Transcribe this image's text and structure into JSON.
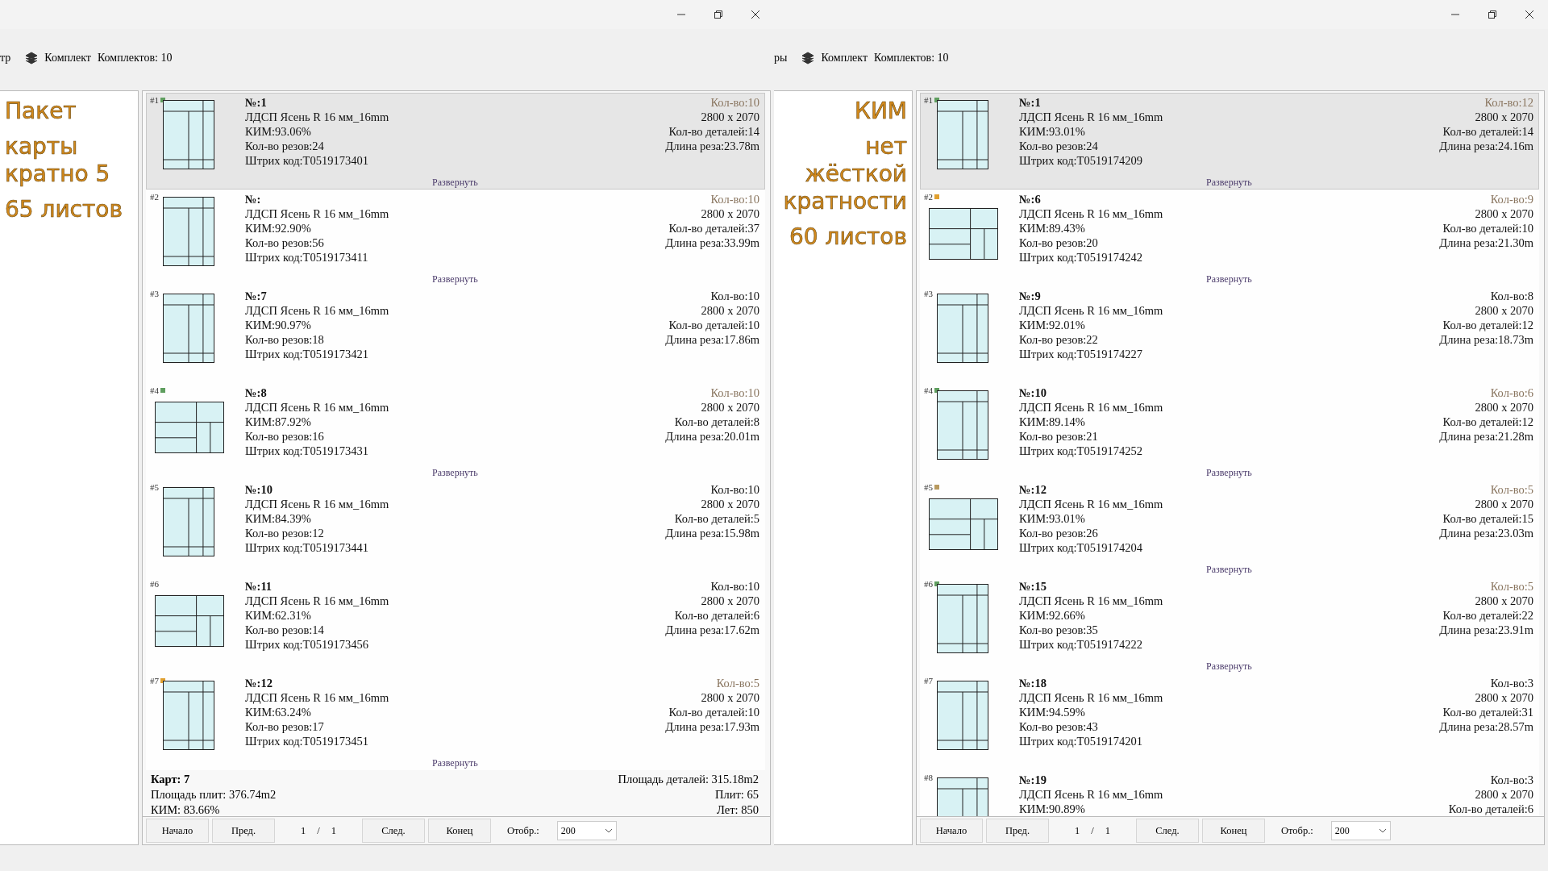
{
  "windows": [
    {
      "toolbar": {
        "cut_label": "тр",
        "set_label": "Комплект",
        "sets_count": "Комплектов: 10"
      },
      "captions": [
        "Пакет",
        "карты кратно 5",
        "65 листов"
      ],
      "sheets": [
        {
          "index": "#1",
          "color": "#5f9e5f",
          "selected": true,
          "kind": "portrait",
          "number": "№:1",
          "material": "ЛДСП Ясень R 16 мм_16mm",
          "kim": "КИМ:93.06%",
          "cuts": "Кол-во резов:24",
          "barcode": "Штрих код:T0519173401",
          "qty": "Кол-во:10",
          "qty_muted": true,
          "size": "2800 x 2070",
          "parts": "Кол-во деталей:14",
          "cut_length": "Длина реза:23.78m",
          "expand": "Развернуть"
        },
        {
          "index": "#2",
          "selected": false,
          "kind": "portrait",
          "number": "№:",
          "material": "ЛДСП Ясень R 16 мм_16mm",
          "kim": "КИМ:92.90%",
          "cuts": "Кол-во резов:56",
          "barcode": "Штрих код:T0519173411",
          "qty": "Кол-во:10",
          "qty_muted": true,
          "size": "2800 x 2070",
          "parts": "Кол-во деталей:37",
          "cut_length": "Длина реза:33.99m",
          "expand": "Развернуть"
        },
        {
          "index": "#3",
          "selected": false,
          "kind": "portrait",
          "number": "№:7",
          "material": "ЛДСП Ясень R 16 мм_16mm",
          "kim": "КИМ:90.97%",
          "cuts": "Кол-во резов:18",
          "barcode": "Штрих код:T0519173421",
          "qty": "Кол-во:10",
          "qty_muted": false,
          "size": "2800 x 2070",
          "parts": "Кол-во деталей:10",
          "cut_length": "Длина реза:17.86m"
        },
        {
          "index": "#4",
          "color": "#5f9e5f",
          "selected": false,
          "kind": "landscape",
          "number": "№:8",
          "material": "ЛДСП Ясень R 16 мм_16mm",
          "kim": "КИМ:87.92%",
          "cuts": "Кол-во резов:16",
          "barcode": "Штрих код:T0519173431",
          "qty": "Кол-во:10",
          "qty_muted": true,
          "size": "2800 x 2070",
          "parts": "Кол-во деталей:8",
          "cut_length": "Длина реза:20.01m",
          "expand": "Развернуть"
        },
        {
          "index": "#5",
          "selected": false,
          "kind": "portrait",
          "number": "№:10",
          "material": "ЛДСП Ясень R 16 мм_16mm",
          "kim": "КИМ:84.39%",
          "cuts": "Кол-во резов:12",
          "barcode": "Штрих код:T0519173441",
          "qty": "Кол-во:10",
          "qty_muted": false,
          "size": "2800 x 2070",
          "parts": "Кол-во деталей:5",
          "cut_length": "Длина реза:15.98m"
        },
        {
          "index": "#6",
          "selected": false,
          "kind": "landscape",
          "number": "№:11",
          "material": "ЛДСП Ясень R 16 мм_16mm",
          "kim": "КИМ:62.31%",
          "cuts": "Кол-во резов:14",
          "barcode": "Штрих код:T0519173456",
          "qty": "Кол-во:10",
          "qty_muted": false,
          "size": "2800 x 2070",
          "parts": "Кол-во деталей:6",
          "cut_length": "Длина реза:17.62m"
        },
        {
          "index": "#7",
          "color": "#e0a030",
          "selected": false,
          "kind": "portrait",
          "number": "№:12",
          "material": "ЛДСП Ясень R 16 мм_16mm",
          "kim": "КИМ:63.24%",
          "cuts": "Кол-во резов:17",
          "barcode": "Штрих код:T0519173451",
          "qty": "Кол-во:5",
          "qty_muted": true,
          "size": "2800 x 2070",
          "parts": "Кол-во деталей:10",
          "cut_length": "Длина реза:17.93m",
          "expand": "Развернуть"
        }
      ],
      "summary": {
        "left": [
          "Карт: 7",
          "Площадь плит: 376.74m2",
          "КИМ: 83.66%"
        ],
        "right": [
          "Площадь деталей: 315.18m2",
          "Плит: 65",
          "Лет: 850"
        ]
      },
      "pager": {
        "first": "Начало",
        "prev": "Пред.",
        "page": "1",
        "separator": "/",
        "total": "1",
        "next": "След.",
        "last": "Конец",
        "show_label": "Отобр.:",
        "show_value": "200"
      }
    },
    {
      "toolbar": {
        "cut_label": "ры",
        "set_label": "Комплект",
        "sets_count": "Комплектов: 10"
      },
      "captions": [
        "КИМ",
        "нет жёсткой кратности",
        "60 листов"
      ],
      "sheets": [
        {
          "index": "#1",
          "color": "#5f9e5f",
          "selected": true,
          "kind": "portrait",
          "number": "№:1",
          "material": "ЛДСП Ясень R 16 мм_16mm",
          "kim": "КИМ:93.01%",
          "cuts": "Кол-во резов:24",
          "barcode": "Штрих код:T0519174209",
          "qty": "Кол-во:12",
          "qty_muted": true,
          "size": "2800 x 2070",
          "parts": "Кол-во деталей:14",
          "cut_length": "Длина реза:24.16m",
          "expand": "Развернуть"
        },
        {
          "index": "#2",
          "color": "#e0a030",
          "selected": false,
          "kind": "landscape",
          "number": "№:6",
          "material": "ЛДСП Ясень R 16 мм_16mm",
          "kim": "КИМ:89.43%",
          "cuts": "Кол-во резов:20",
          "barcode": "Штрих код:T0519174242",
          "qty": "Кол-во:9",
          "qty_muted": true,
          "size": "2800 x 2070",
          "parts": "Кол-во деталей:10",
          "cut_length": "Длина реза:21.30m",
          "expand": "Развернуть"
        },
        {
          "index": "#3",
          "selected": false,
          "kind": "portrait",
          "number": "№:9",
          "material": "ЛДСП Ясень R 16 мм_16mm",
          "kim": "КИМ:92.01%",
          "cuts": "Кол-во резов:22",
          "barcode": "Штрих код:T0519174227",
          "qty": "Кол-во:8",
          "qty_muted": false,
          "size": "2800 x 2070",
          "parts": "Кол-во деталей:12",
          "cut_length": "Длина реза:18.73m"
        },
        {
          "index": "#4",
          "color": "#5f9e5f",
          "selected": false,
          "kind": "portrait",
          "number": "№:10",
          "material": "ЛДСП Ясень R 16 мм_16mm",
          "kim": "КИМ:89.14%",
          "cuts": "Кол-во резов:21",
          "barcode": "Штрих код:T0519174252",
          "qty": "Кол-во:6",
          "qty_muted": true,
          "size": "2800 x 2070",
          "parts": "Кол-во деталей:12",
          "cut_length": "Длина реза:21.28m",
          "expand": "Развернуть"
        },
        {
          "index": "#5",
          "color": "#b89a60",
          "selected": false,
          "kind": "landscape",
          "number": "№:12",
          "material": "ЛДСП Ясень R 16 мм_16mm",
          "kim": "КИМ:93.01%",
          "cuts": "Кол-во резов:26",
          "barcode": "Штрих код:T0519174204",
          "qty": "Кол-во:5",
          "qty_muted": true,
          "size": "2800 x 2070",
          "parts": "Кол-во деталей:15",
          "cut_length": "Длина реза:23.03m",
          "expand": "Развернуть"
        },
        {
          "index": "#6",
          "color": "#5f9e5f",
          "selected": false,
          "kind": "portrait",
          "number": "№:15",
          "material": "ЛДСП Ясень R 16 мм_16mm",
          "kim": "КИМ:92.66%",
          "cuts": "Кол-во резов:35",
          "barcode": "Штрих код:T0519174222",
          "qty": "Кол-во:5",
          "qty_muted": true,
          "size": "2800 x 2070",
          "parts": "Кол-во деталей:22",
          "cut_length": "Длина реза:23.91m",
          "expand": "Развернуть"
        },
        {
          "index": "#7",
          "selected": false,
          "kind": "portrait",
          "number": "№:18",
          "material": "ЛДСП Ясень R 16 мм_16mm",
          "kim": "КИМ:94.59%",
          "cuts": "Кол-во резов:43",
          "barcode": "Штрих код:T0519174201",
          "qty": "Кол-во:3",
          "qty_muted": false,
          "size": "2800 x 2070",
          "parts": "Кол-во деталей:31",
          "cut_length": "Длина реза:28.57m"
        },
        {
          "index": "#8",
          "selected": false,
          "kind": "portrait",
          "number": "№:19",
          "material": "ЛДСП Ясень R 16 мм_16mm",
          "kim": "КИМ:90.89%",
          "qty": "Кол-во:3",
          "qty_muted": false,
          "size": "2800 x 2070",
          "parts": "Кол-во деталей:6"
        }
      ],
      "pager": {
        "first": "Начало",
        "prev": "Пред.",
        "page": "1",
        "separator": "/",
        "total": "1",
        "next": "След.",
        "last": "Конец",
        "show_label": "Отобр.:",
        "show_value": "200"
      }
    }
  ]
}
